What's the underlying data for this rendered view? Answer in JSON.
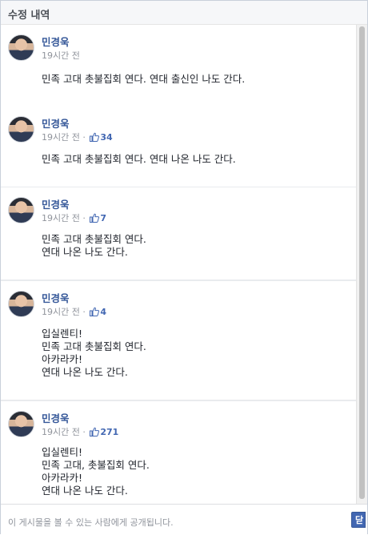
{
  "header": {
    "title": "수정 내역"
  },
  "entries": [
    {
      "author": "민경욱",
      "time": "19시간 전",
      "likes": "",
      "lines": [
        "민족 고대 촛불집회 연다. 연대 출신인 나도 간다."
      ]
    },
    {
      "author": "민경욱",
      "time": "19시간 전 ·",
      "likes": "34",
      "lines": [
        "민족 고대 촛불집회 연다. 연대 나온 나도 간다."
      ]
    },
    {
      "author": "민경욱",
      "time": "19시간 전 ·",
      "likes": "7",
      "lines": [
        "민족 고대 촛불집회 연다.",
        "연대 나온 나도 간다."
      ]
    },
    {
      "author": "민경욱",
      "time": "19시간 전 ·",
      "likes": "4",
      "lines": [
        "입실렌티!",
        "민족 고대 촛불집회 연다.",
        "아카라카!",
        "연대 나온 나도 간다."
      ]
    },
    {
      "author": "민경욱",
      "time": "19시간 전 ·",
      "likes": "271",
      "lines": [
        "입실렌티!",
        "민족 고대, 촛불집회 연다.",
        "아카라카!",
        "연대 나온 나도 간다."
      ]
    }
  ],
  "footer": {
    "notice": "이 게시물을 볼 수 있는 사람에게 공개됩니다.",
    "button_label": "닫"
  },
  "icons": {
    "like": "thumbs-up-icon",
    "avatar": "avatar"
  },
  "colors": {
    "link": "#365899",
    "like": "#4267b2",
    "meta": "#90949c"
  }
}
